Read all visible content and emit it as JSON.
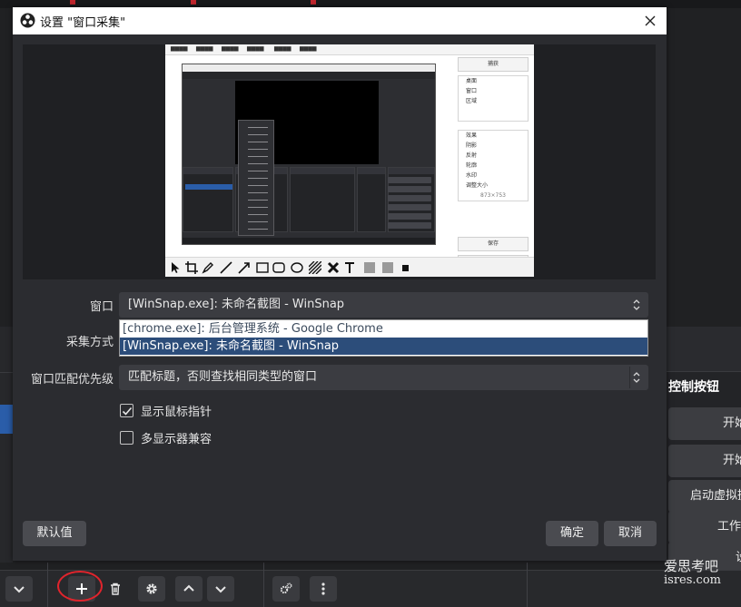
{
  "dialog": {
    "title": "设置 \"窗口采集\"",
    "close_icon": "close-icon"
  },
  "form": {
    "window_label": "窗口",
    "window_value": "[WinSnap.exe]: 未命名截图 - WinSnap",
    "capture_method_label": "采集方式",
    "window_options": [
      "[chrome.exe]: 后台管理系统 - Google Chrome",
      "[WinSnap.exe]: 未命名截图 - WinSnap"
    ],
    "match_priority_label": "窗口匹配优先级",
    "match_priority_value": "匹配标题，否则查找相同类型的窗口",
    "show_cursor_label": "显示鼠标指针",
    "show_cursor_checked": true,
    "multi_display_label": "多显示器兼容",
    "multi_display_checked": false
  },
  "buttons": {
    "defaults": "默认值",
    "ok": "确定",
    "cancel": "取消"
  },
  "preview_shot": {
    "side_capture": "捕获",
    "side_group1": [
      "桌面",
      "窗口",
      "区域"
    ],
    "side_group2_title": "效果",
    "side_group2": [
      "阴影",
      "反射",
      "轮廓",
      "水印",
      "调整大小"
    ],
    "side_save": "保存",
    "side_copy": "复制",
    "size_text": "873×753"
  },
  "background": {
    "controls_title": "控制按钮",
    "controls_buttons": [
      "开始",
      "开始",
      "启动虚拟摄",
      "工作",
      "设",
      "退"
    ]
  },
  "watermark": {
    "line1": "爱思考吧",
    "line2": "isres.com"
  },
  "colors": {
    "accent": "#2c4d7a",
    "highlight_circle": "#e0242c"
  }
}
